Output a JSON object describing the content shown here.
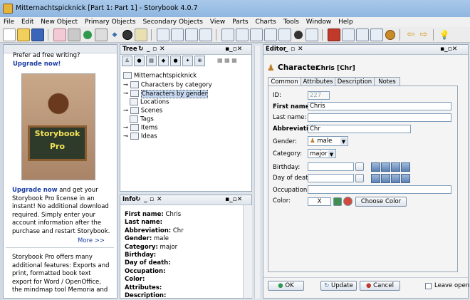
{
  "window": {
    "title": "Mitternachtspicknick [Part 1: Part 1] - Storybook 4.0.7"
  },
  "menu": [
    "File",
    "Edit",
    "New Object",
    "Primary Objects",
    "Secondary Objects",
    "View",
    "Parts",
    "Charts",
    "Tools",
    "Window",
    "Help"
  ],
  "ad": {
    "prefer": "Prefer ad free writing? ",
    "prefer_link": "Upgrade now!",
    "board_line1": "Storybook",
    "board_line2": "Pro",
    "upgrade_link": "Upgrade now",
    "upgrade_text": " and get your Storybook Pro license in an instant! No additional download required. Simply enter your account information after the purchase and restart Storybook.",
    "more": "More >>",
    "pro_text": "Storybook Pro offers many additional features: Exports and print, formatted book text export for Word / OpenOffice, the mindmap tool Memoria and"
  },
  "tree": {
    "title": "Tree",
    "root": "Mitternachtspicknick",
    "items": [
      "Characters by category",
      "Characters by gender",
      "Locations",
      "Scenes",
      "Tags",
      "Items",
      "Ideas"
    ]
  },
  "info": {
    "title": "Info",
    "rows": [
      {
        "label": "First name:",
        "value": " Chris"
      },
      {
        "label": "Last name:",
        "value": ""
      },
      {
        "label": "Abbreviation:",
        "value": " Chr"
      },
      {
        "label": "Gender:",
        "value": " male"
      },
      {
        "label": "Category:",
        "value": " major"
      },
      {
        "label": "Birthday:",
        "value": ""
      },
      {
        "label": "Day of death:",
        "value": ""
      },
      {
        "label": "Occupation:",
        "value": ""
      },
      {
        "label": "Color:",
        "value": ""
      },
      {
        "label": "Attributes:",
        "value": ""
      },
      {
        "label": "Description:",
        "value": ""
      }
    ]
  },
  "editor": {
    "title": "Editor",
    "heading": "Character",
    "subheading": "Chris [Chr]",
    "tabs": [
      "Common",
      "Attributes",
      "Description",
      "Notes"
    ],
    "id_label": "ID:",
    "id_value": "227",
    "first_label": "First name:",
    "first_value": "Chris",
    "last_label": "Last name:",
    "last_value": "",
    "abbr_label": "Abbreviation:",
    "abbr_value": "Chr",
    "gender_label": "Gender:",
    "gender_value": "male",
    "category_label": "Category:",
    "category_value": "major",
    "birthday_label": "Birthday:",
    "death_label": "Day of death:",
    "occupation_label": "Occupation:",
    "color_label": "Color:",
    "color_value": "X",
    "choose_color": "Choose Color",
    "ok": "OK",
    "update": "Update",
    "cancel": "Cancel",
    "leave_open": "Leave open"
  },
  "colors": {
    "link": "#1d3fa5",
    "titlebar": "#9cc0e6"
  }
}
